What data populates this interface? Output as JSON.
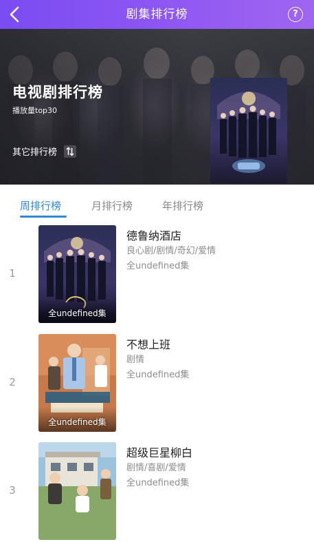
{
  "header": {
    "title": "剧集排行榜",
    "help_label": "?"
  },
  "banner": {
    "title": "电视剧排行榜",
    "subtitle": "播放量top30",
    "other_label": "其它排行榜"
  },
  "tabs": [
    {
      "label": "周排行榜",
      "active": true
    },
    {
      "label": "月排行榜",
      "active": false
    },
    {
      "label": "年排行榜",
      "active": false
    }
  ],
  "list": [
    {
      "rank": "1",
      "title": "德鲁纳酒店",
      "genre": "良心剧/剧情/奇幻/爱情",
      "episodes": "全undefined集",
      "poster_badge": "全undefined集"
    },
    {
      "rank": "2",
      "title": "不想上班",
      "genre": "剧情",
      "episodes": "全undefined集",
      "poster_badge": "全undefined集"
    },
    {
      "rank": "3",
      "title": "超级巨星柳白",
      "genre": "剧情/喜剧/爱情",
      "episodes": "全undefined集",
      "poster_badge": ""
    }
  ],
  "colors": {
    "header_start": "#7b4cf2",
    "header_end": "#a065f0",
    "tab_active": "#2f86d6",
    "tab_inactive": "#888888",
    "text_primary": "#222222",
    "text_secondary": "#8d8d8d"
  }
}
